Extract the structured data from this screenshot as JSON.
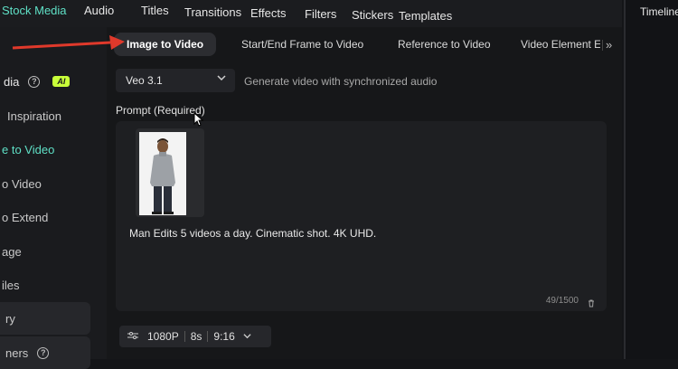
{
  "topbar": {
    "items": [
      "Stock Media",
      "Audio",
      "Titles",
      "Transitions",
      "Effects",
      "Filters",
      "Stickers",
      "Templates"
    ],
    "active_index": 0
  },
  "right_panel": {
    "title": "Timeline"
  },
  "sidebar": {
    "header_label": "dia",
    "ai_badge": "AI",
    "items": [
      "Inspiration",
      "e to Video",
      "o Video",
      "o Extend",
      "age",
      "iles",
      "ry",
      "ners"
    ],
    "active_index": 1
  },
  "tabs": {
    "items": [
      "Image to Video",
      "Start/End Frame to Video",
      "Reference to Video",
      "Video Element Ec"
    ],
    "active_index": 0,
    "more_glyph": "»"
  },
  "model": {
    "selected": "Veo 3.1",
    "description": "Generate video with synchronized audio"
  },
  "prompt": {
    "label": "Prompt (Required)",
    "text": "Man Edits 5 videos a day. Cinematic shot. 4K UHD.",
    "counter": "49/1500"
  },
  "settings": {
    "resolution": "1080P",
    "duration": "8s",
    "aspect": "9:16"
  },
  "colors": {
    "accent": "#5fe0c6",
    "ai_badge": "#c9ff3a",
    "annotation_arrow": "#e0392b"
  }
}
